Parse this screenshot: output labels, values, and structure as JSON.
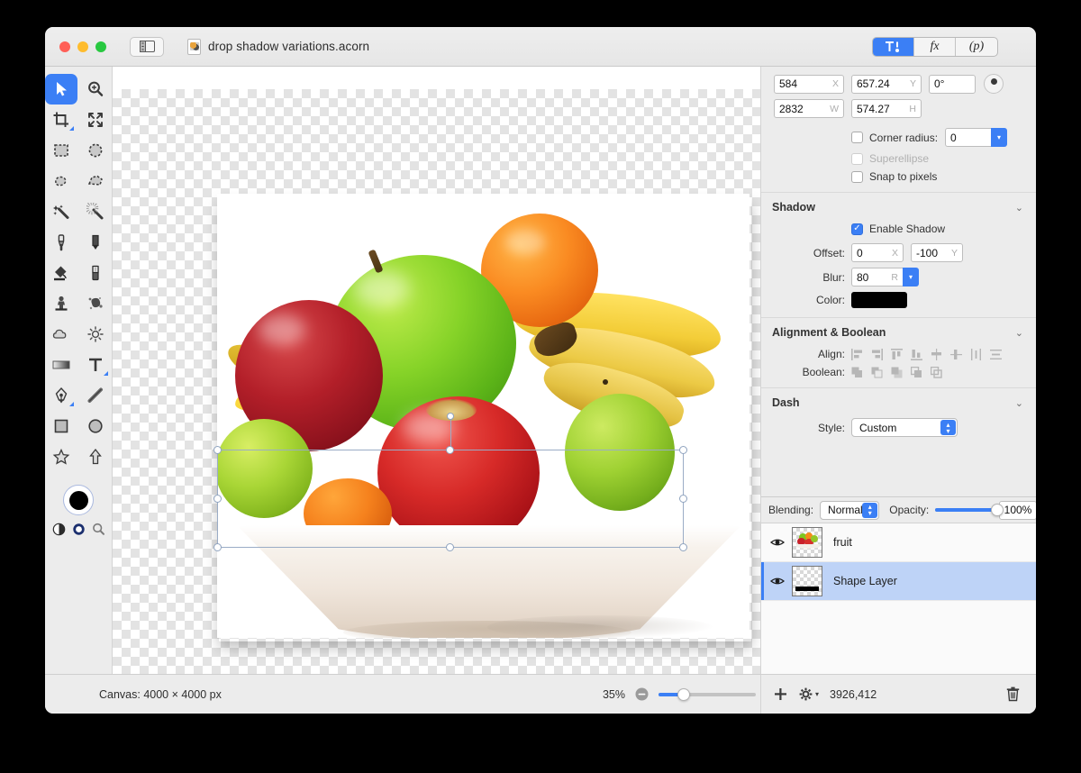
{
  "window": {
    "title": "drop shadow variations.acorn",
    "accent": "#3b7ff5",
    "chrome_bg": "#ececec"
  },
  "titlebar": {
    "traffic_lights": [
      "close",
      "minimize",
      "zoom"
    ],
    "sidebar_toggle": "sidebar-toggle",
    "doc_icon": "acorn-document-icon",
    "segments": [
      {
        "name": "tools-inspector",
        "label": "",
        "active": true
      },
      {
        "name": "filters-inspector",
        "label": "fx",
        "active": false
      },
      {
        "name": "palette-inspector",
        "label": "(p)",
        "active": false
      }
    ]
  },
  "toolbox": {
    "tools": [
      {
        "name": "move-tool",
        "icon": "cursor-arrow-icon",
        "active": true
      },
      {
        "name": "zoom-tool",
        "icon": "magnifier-plus-icon",
        "active": false
      },
      {
        "name": "crop-tool",
        "icon": "crop-icon",
        "active": false,
        "has_corner": true
      },
      {
        "name": "transform-tool",
        "icon": "arrows-expand-icon",
        "active": false
      },
      {
        "name": "rect-select-tool",
        "icon": "marquee-rect-icon",
        "active": false
      },
      {
        "name": "ellipse-select-tool",
        "icon": "marquee-ellipse-icon",
        "active": false
      },
      {
        "name": "lasso-tool",
        "icon": "lasso-icon",
        "active": false
      },
      {
        "name": "polygon-lasso-tool",
        "icon": "polygon-lasso-icon",
        "active": false
      },
      {
        "name": "magic-wand-tool",
        "icon": "magic-wand-icon",
        "active": false
      },
      {
        "name": "instant-alpha-tool",
        "icon": "instant-alpha-icon",
        "active": false
      },
      {
        "name": "brush-tool",
        "icon": "brush-icon",
        "active": false
      },
      {
        "name": "pencil-tool",
        "icon": "pencil-icon",
        "active": false
      },
      {
        "name": "paint-bucket-tool",
        "icon": "paint-bucket-icon",
        "active": false
      },
      {
        "name": "eraser-tool",
        "icon": "eraser-icon",
        "active": false
      },
      {
        "name": "clone-stamp-tool",
        "icon": "clone-stamp-icon",
        "active": false
      },
      {
        "name": "smudge-tool",
        "icon": "smudge-splatter-icon",
        "active": false
      },
      {
        "name": "dodge-burn-tool",
        "icon": "cloud-burn-icon",
        "active": false
      },
      {
        "name": "brightness-tool",
        "icon": "sun-icon",
        "active": false
      },
      {
        "name": "gradient-tool",
        "icon": "gradient-icon",
        "active": false
      },
      {
        "name": "text-tool",
        "icon": "text-t-icon",
        "active": false,
        "has_corner": true
      },
      {
        "name": "bezier-pen-tool",
        "icon": "pen-nib-icon",
        "active": false,
        "has_corner": true
      },
      {
        "name": "line-tool",
        "icon": "line-icon",
        "active": false
      },
      {
        "name": "rectangle-shape-tool",
        "icon": "square-shape-icon",
        "active": false
      },
      {
        "name": "ellipse-shape-tool",
        "icon": "circle-shape-icon",
        "active": false
      },
      {
        "name": "star-shape-tool",
        "icon": "star-icon",
        "active": false
      },
      {
        "name": "arrow-shape-tool",
        "icon": "arrow-up-icon",
        "active": false
      }
    ],
    "color_swatch": {
      "name": "foreground-color-swatch",
      "fill": "#000000",
      "stroke": "#ffffff"
    },
    "swatch_extras": [
      {
        "name": "swap-colors-icon"
      },
      {
        "name": "stroke-fill-toggle-icon"
      },
      {
        "name": "color-picker-icon"
      }
    ]
  },
  "canvas": {
    "artboard_label": "fruit-bowl-artboard",
    "selection": {
      "name": "shape-layer-selection",
      "handles": 8,
      "rotation_handle": true
    }
  },
  "statusbar": {
    "canvas_label": "Canvas: 4000 × 4000 px",
    "zoom_percent": "35%",
    "zoom_out_icon": "zoom-out-icon",
    "zoom_in_icon": "zoom-in-icon",
    "fit_icon": "fit-to-window-icon"
  },
  "status_right": {
    "add_icon": "add-layer-icon",
    "gear_icon": "layer-actions-gear-icon",
    "coords": "3926,412",
    "trash_icon": "delete-layer-icon"
  },
  "inspector": {
    "geometry": {
      "x": {
        "value": "584",
        "unit": "X"
      },
      "y": {
        "value": "657.24",
        "unit": "Y"
      },
      "rotation": {
        "value": "0°"
      },
      "w": {
        "value": "2832",
        "unit": "W"
      },
      "h": {
        "value": "574.27",
        "unit": "H"
      },
      "corner_radius_label": "Corner radius:",
      "corner_radius_value": "0",
      "corner_radius_checked": false,
      "superellipse_label": "Superellipse",
      "superellipse_checked": false,
      "superellipse_disabled": true,
      "snap_label": "Snap to pixels",
      "snap_checked": false,
      "rotation_knob": "rotation-dial"
    },
    "shadow": {
      "title": "Shadow",
      "enable_label": "Enable Shadow",
      "enable_checked": true,
      "offset_label": "Offset:",
      "offset_x": "0",
      "offset_x_unit": "X",
      "offset_y": "-100",
      "offset_y_unit": "Y",
      "blur_label": "Blur:",
      "blur_value": "80",
      "blur_unit": "R",
      "color_label": "Color:",
      "color_value": "#000000"
    },
    "alignment": {
      "title": "Alignment & Boolean",
      "align_label": "Align:",
      "align_icons": [
        "align-left-icon",
        "align-right-icon",
        "align-top-icon",
        "align-bottom-icon",
        "align-center-horizontal-icon",
        "align-center-vertical-icon",
        "distribute-horizontal-icon",
        "distribute-vertical-icon"
      ],
      "boolean_label": "Boolean:",
      "boolean_icons": [
        "boolean-union-icon",
        "boolean-subtract-icon",
        "boolean-intersect-icon",
        "boolean-exclude-icon",
        "boolean-divide-icon"
      ]
    },
    "dash": {
      "title": "Dash",
      "style_label": "Style:",
      "style_value": "Custom"
    }
  },
  "layers_panel": {
    "blending_label": "Blending:",
    "blending_value": "Normal",
    "opacity_label": "Opacity:",
    "opacity_value": "100%",
    "layers": [
      {
        "name": "fruit",
        "visible": true,
        "selected": false,
        "thumb": "fruit-bowl-thumb"
      },
      {
        "name": "Shape Layer",
        "visible": true,
        "selected": true,
        "thumb": "black-bar-thumb"
      }
    ]
  }
}
